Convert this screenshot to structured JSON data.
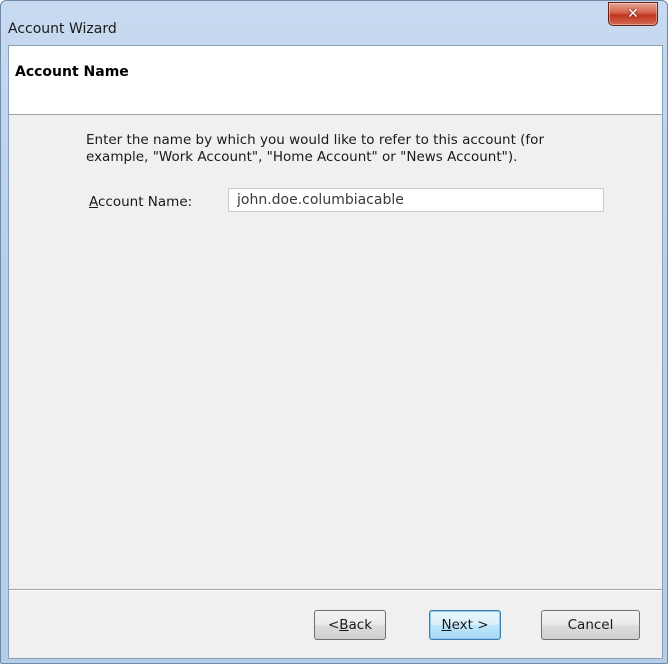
{
  "window": {
    "title": "Account Wizard",
    "close_glyph": "✕"
  },
  "header": {
    "title": "Account Name"
  },
  "main": {
    "description_line1": "Enter the name by which you would like to refer to this account (for",
    "description_line2": "example, \"Work Account\", \"Home Account\" or \"News Account\").",
    "account_name_label_mnemonic": "A",
    "account_name_label_rest": "ccount Name:",
    "account_name_value": "john.doe.columbiacable"
  },
  "buttons": {
    "back_prefix": "< ",
    "back_mnemonic": "B",
    "back_rest": "ack",
    "next_mnemonic": "N",
    "next_rest": "ext >",
    "cancel_label": "Cancel"
  },
  "colors": {
    "frame": "#b9cfe9",
    "close_button": "#c0341c",
    "client_background": "#f0f0f0",
    "default_button": "#bee6fd"
  }
}
